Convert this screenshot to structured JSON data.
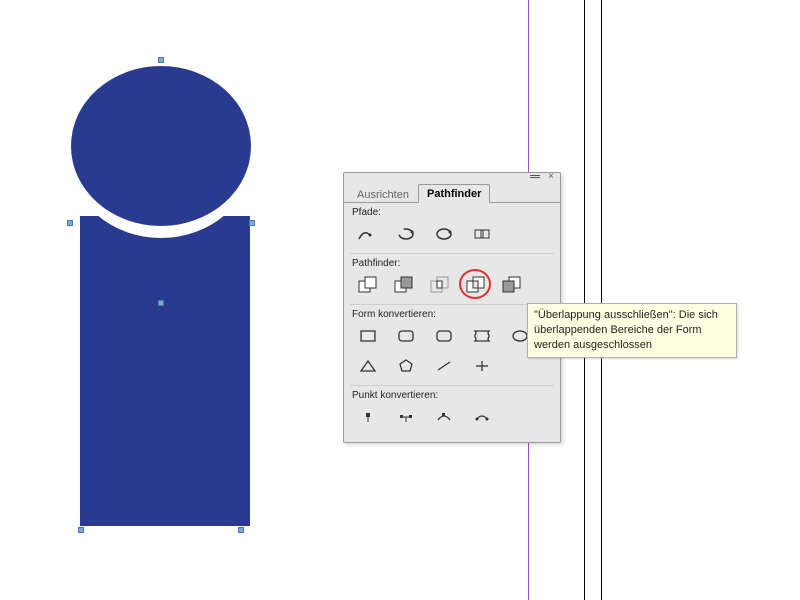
{
  "shape_color": "#2a3a8f",
  "panel": {
    "tabs": [
      {
        "label": "Ausrichten",
        "active": false
      },
      {
        "label": "Pathfinder",
        "active": true
      }
    ],
    "sections": {
      "paths_label": "Pfade:",
      "pathfinder_label": "Pathfinder:",
      "convert_shape_label": "Form konvertieren:",
      "convert_point_label": "Punkt konvertieren:"
    },
    "pathfinder_buttons": [
      {
        "name": "add"
      },
      {
        "name": "subtract"
      },
      {
        "name": "intersect"
      },
      {
        "name": "exclude-overlap",
        "highlighted": true
      },
      {
        "name": "minus-back"
      }
    ]
  },
  "tooltip": {
    "text": "\"Überlappung ausschließen\": Die sich überlappenden Bereiche der Form werden ausgeschlossen"
  }
}
